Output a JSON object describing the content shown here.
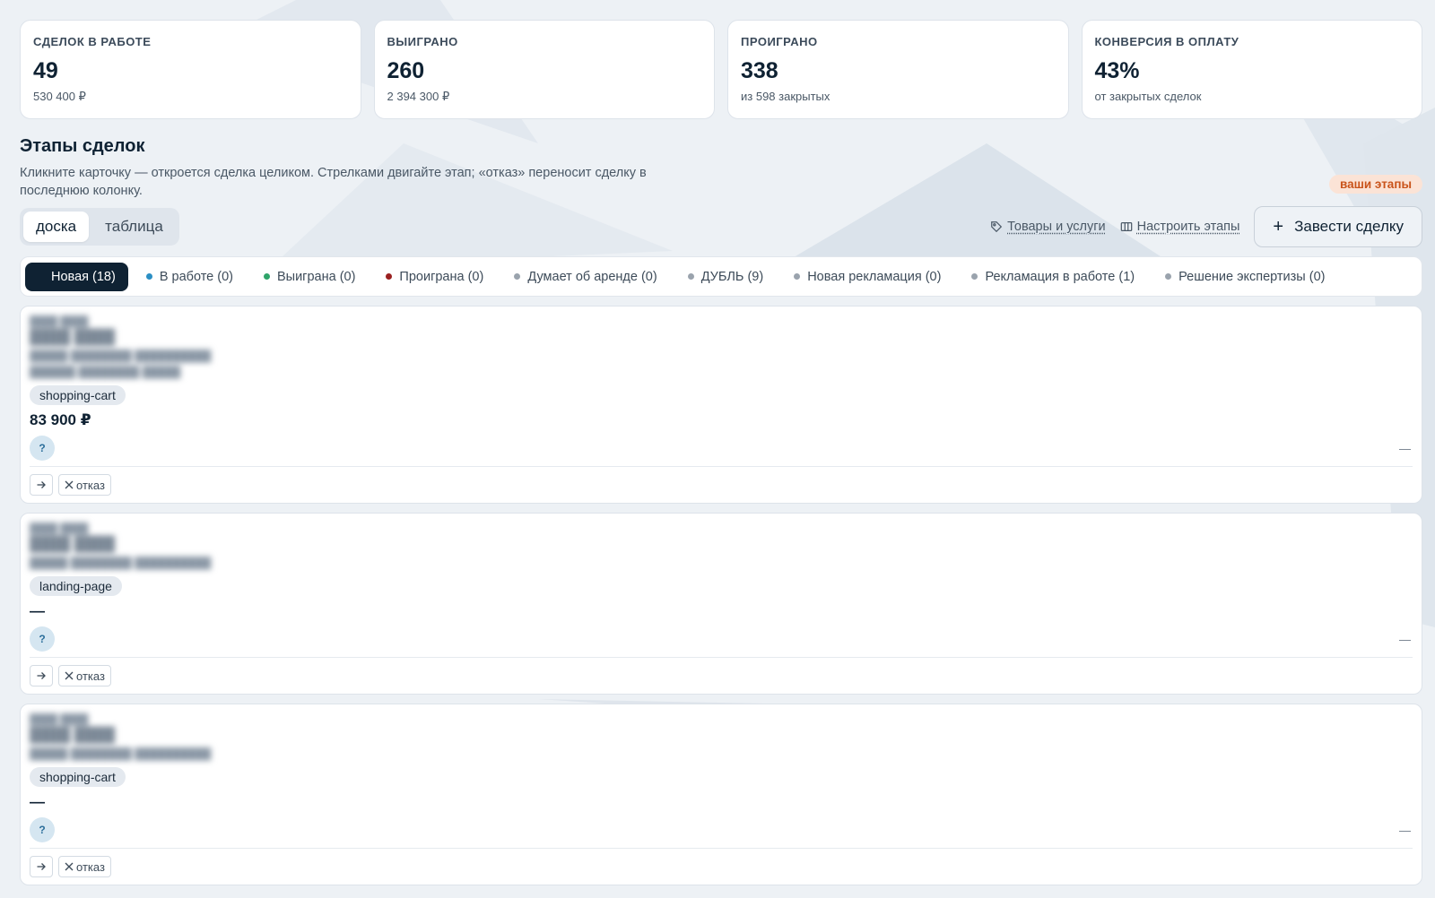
{
  "stats": [
    {
      "label": "СДЕЛОК В РАБОТЕ",
      "value": "49",
      "sub": "530 400 ₽"
    },
    {
      "label": "ВЫИГРАНО",
      "value": "260",
      "sub": "2 394 300 ₽"
    },
    {
      "label": "ПРОИГРАНО",
      "value": "338",
      "sub": "из 598 закрытых"
    },
    {
      "label": "КОНВЕРСИЯ В ОПЛАТУ",
      "value": "43%",
      "sub": "от закрытых сделок"
    }
  ],
  "section": {
    "title": "Этапы сделок",
    "description": "Кликните карточку — откроется сделка целиком. Стрелками двигайте этап; «отказ» переносит сделку в последнюю колонку.",
    "badge": "ваши этапы"
  },
  "view_toggle": {
    "board": "доска",
    "table": "таблица"
  },
  "toolbar": {
    "products_link": "Товары и услуги",
    "configure_link": "Настроить этапы",
    "new_deal": "Завести сделку",
    "plus": "+"
  },
  "stage_tabs": [
    {
      "label": "Новая (18)",
      "color": "#0f2233"
    },
    {
      "label": "В работе (0)",
      "color": "#2b8fc4"
    },
    {
      "label": "Выиграна (0)",
      "color": "#2fa46a"
    },
    {
      "label": "Проиграна (0)",
      "color": "#9a2020"
    },
    {
      "label": "Думает об аренде (0)",
      "color": "#9aa3ad"
    },
    {
      "label": "ДУБЛЬ (9)",
      "color": "#9aa3ad"
    },
    {
      "label": "Новая рекламация (0)",
      "color": "#9aa3ad"
    },
    {
      "label": "Рекламация в работе (1)",
      "color": "#9aa3ad"
    },
    {
      "label": "Решение экспертизы (0)",
      "color": "#9aa3ad"
    }
  ],
  "cards": [
    {
      "tag": "shopping-cart",
      "amount": "83 900 ₽",
      "avatar": "?",
      "right": "—",
      "reject": "отказ",
      "blur_lines": 2
    },
    {
      "tag": "landing-page",
      "amount": "—",
      "avatar": "?",
      "right": "—",
      "reject": "отказ",
      "blur_lines": 1
    },
    {
      "tag": "shopping-cart",
      "amount": "—",
      "avatar": "?",
      "right": "—",
      "reject": "отказ",
      "blur_lines": 1
    }
  ],
  "icons": {
    "tag": "tag-icon",
    "columns": "columns-icon",
    "arrow": "arrow-right-icon",
    "close": "close-icon"
  }
}
